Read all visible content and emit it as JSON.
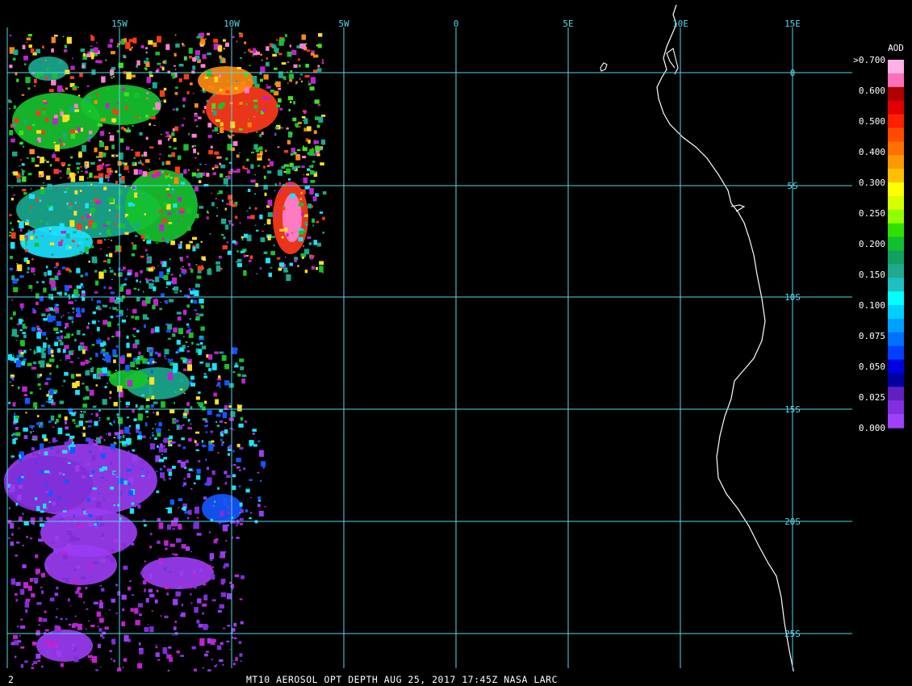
{
  "product_title": "MT10  AEROSOL OPT DEPTH   AUG 25, 2017 17:45Z   NASA LARC",
  "corner_label": "2",
  "longitude_labels": [
    "15W",
    "10W",
    "5W",
    "0",
    "5E",
    "10E",
    "15E"
  ],
  "latitude_labels": [
    "0",
    "5S",
    "10S",
    "15S",
    "20S",
    "25S"
  ],
  "legend": {
    "title": "AOD",
    "labels": [
      ">0.700",
      "0.600",
      "0.500",
      "0.400",
      "0.300",
      "0.250",
      "0.200",
      "0.150",
      "0.100",
      "0.075",
      "0.050",
      "0.025",
      "0.000"
    ],
    "colors": [
      "#ffb0e6",
      "#ff70b8",
      "#b00000",
      "#e00000",
      "#ff2000",
      "#ff4a00",
      "#ff7000",
      "#ff9800",
      "#ffc000",
      "#ffff00",
      "#d8ff00",
      "#90ff00",
      "#30e000",
      "#10c030",
      "#10a060",
      "#20a890",
      "#20c0c0",
      "#00ffff",
      "#00d0ff",
      "#00a0ff",
      "#0070ff",
      "#0040ff",
      "#0000e0",
      "#0000a0",
      "#6020c0",
      "#8030e0",
      "#a040ff"
    ]
  },
  "field_colors": {
    "violet": "#9a3cf2",
    "deep_violet": "#7f2fd8",
    "blue": "#1456ff",
    "cyan": "#1ae2ff",
    "teal": "#1aa88e",
    "green": "#16c22c",
    "bright_green": "#40e020",
    "magenta": "#c022d0",
    "red": "#ff3a1a",
    "orange": "#ff8a10",
    "yellow": "#ffe020",
    "pink": "#ff80d0",
    "grid": "#55d8e8",
    "coast": "#ffffff"
  }
}
